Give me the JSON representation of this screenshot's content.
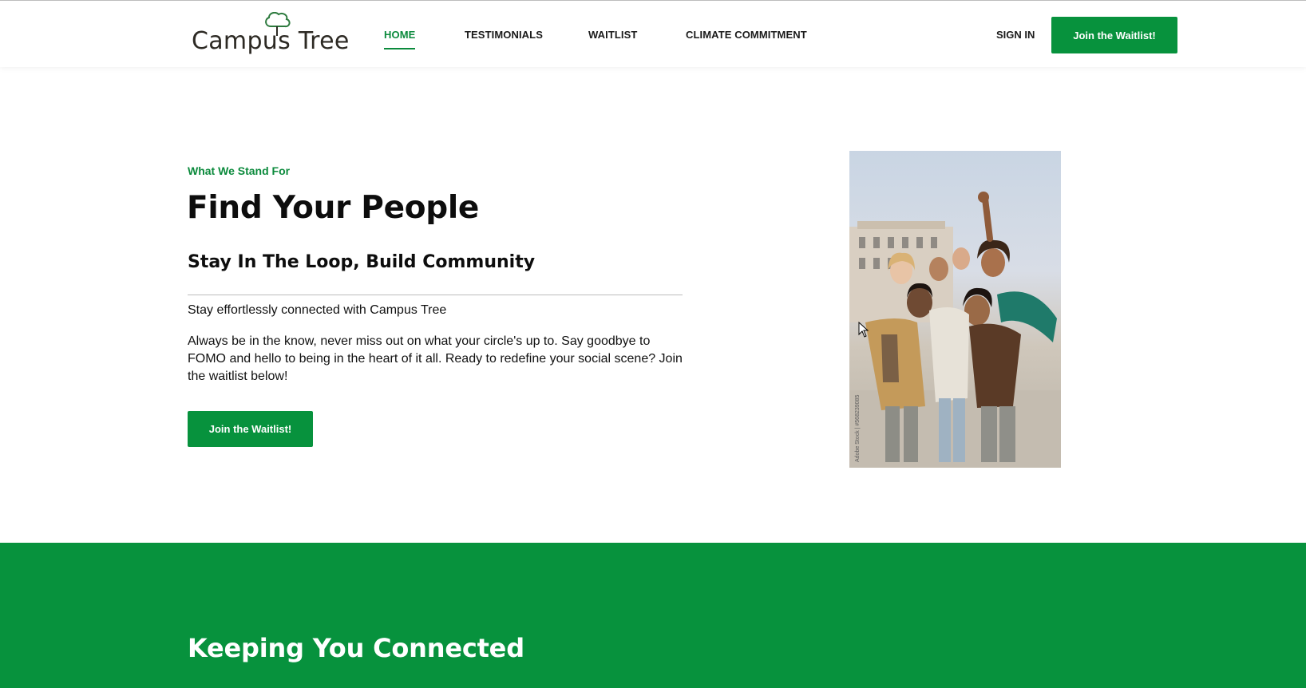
{
  "header": {
    "logo_text": "Campus Tree",
    "nav": [
      {
        "label": "HOME",
        "active": true
      },
      {
        "label": "TESTIMONIALS",
        "active": false
      },
      {
        "label": "WAITLIST",
        "active": false
      },
      {
        "label": "CLIMATE COMMITMENT",
        "active": false
      }
    ],
    "sign_in_label": "SIGN IN",
    "cta_label": "Join the Waitlist!"
  },
  "hero": {
    "eyebrow": "What We Stand For",
    "title": "Find Your People",
    "subtitle": "Stay In The Loop, Build Community",
    "lead": "Stay effortlessly connected with Campus Tree",
    "body": "Always be in the know, never miss out on what your circle's up to. Say goodbye to FOMO and hello to being in the heart of it all. Ready to redefine your social scene? Join the waitlist below!",
    "cta_label": "Join the Waitlist!",
    "photo_watermark": "Adobe Stock | #568239085"
  },
  "band": {
    "title": "Keeping You Connected"
  },
  "colors": {
    "brand_green": "#07923d",
    "text_dark": "#111111"
  }
}
